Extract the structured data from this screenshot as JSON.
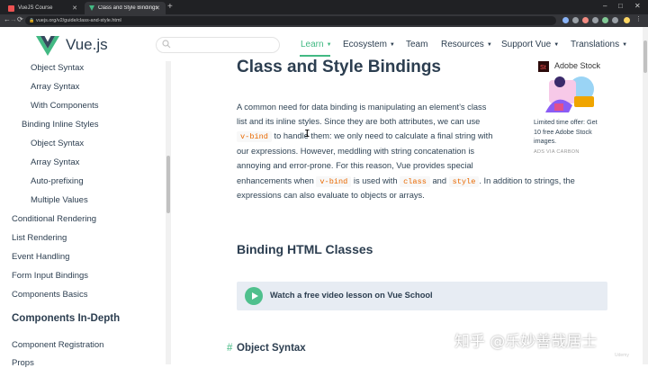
{
  "browser": {
    "tabs": [
      {
        "title": "VueJS Course",
        "active": false
      },
      {
        "title": "Class and Style Bindings — Vue.js",
        "active": true
      }
    ],
    "new_tab": "+",
    "url": "vuejs.org/v2/guide/class-and-style.html",
    "controls": {
      "back": "←",
      "forward": "→",
      "reload": "⟳",
      "minimize": "–",
      "maximize": "□",
      "close": "✕"
    }
  },
  "header": {
    "brand": "Vue.js",
    "search": {
      "placeholder": ""
    },
    "nav": [
      {
        "label": "Learn",
        "dropdown": true,
        "active": true
      },
      {
        "label": "Ecosystem",
        "dropdown": true
      },
      {
        "label": "Team",
        "dropdown": false
      },
      {
        "label": "Resources",
        "dropdown": true
      },
      {
        "label": "Support Vue",
        "dropdown": true
      },
      {
        "label": "Translations",
        "dropdown": true
      }
    ],
    "caret": "▼"
  },
  "sidebar": {
    "items": [
      {
        "label": "Object Syntax",
        "level": 3
      },
      {
        "label": "Array Syntax",
        "level": 3
      },
      {
        "label": "With Components",
        "level": 3
      },
      {
        "label": "Binding Inline Styles",
        "level": 2
      },
      {
        "label": "Object Syntax",
        "level": 3
      },
      {
        "label": "Array Syntax",
        "level": 3
      },
      {
        "label": "Auto-prefixing",
        "level": 3
      },
      {
        "label": "Multiple Values",
        "level": 3
      },
      {
        "label": "Conditional Rendering",
        "level": 1
      },
      {
        "label": "List Rendering",
        "level": 1
      },
      {
        "label": "Event Handling",
        "level": 1
      },
      {
        "label": "Form Input Bindings",
        "level": 1
      },
      {
        "label": "Components Basics",
        "level": 1
      }
    ],
    "section_title": "Components In-Depth",
    "section_items": [
      {
        "label": "Component Registration"
      },
      {
        "label": "Props"
      }
    ]
  },
  "main": {
    "title": "Class and Style Bindings",
    "intro": {
      "line1": "A common need for data binding is manipulating an element’s class",
      "line2": "list and its inline styles. Since they are both attributes, we can use",
      "line3_code": "v-bind",
      "line3_a": " to hand",
      "line3_b": "le them: we only need to calculate a final string with",
      "line4": "our expressions. However, meddling with string concatenation is",
      "line5": "annoying and error-prone. For this reason, Vue provides special",
      "line6_a": "enhancements when ",
      "line6_code1": "v-bind",
      "line6_b": " is used with ",
      "line6_code2": "class",
      "line6_c": " and ",
      "line6_code3": "style",
      "line6_d": ". In addition to strings, the",
      "line7": "expressions can also evaluate to objects or arrays."
    },
    "cursor": "I",
    "section_heading": "Binding HTML Classes",
    "video_lesson": "Watch a free video lesson on Vue School",
    "subheading_hash": "#",
    "subheading": "Object Syntax"
  },
  "ad": {
    "brand": "Adobe Stock",
    "text_lines": [
      "Limited time offer: Get",
      "10 free Adobe Stock",
      "images."
    ],
    "via": "ADS VIA CARBON"
  },
  "overlay": {
    "watermark": "知乎 @乐妙善哉居士",
    "corner": "Udemy"
  },
  "colors": {
    "accent": "#42b983",
    "text": "#2c3e50",
    "code": "#e96900",
    "chrome_dark": "#202124"
  }
}
